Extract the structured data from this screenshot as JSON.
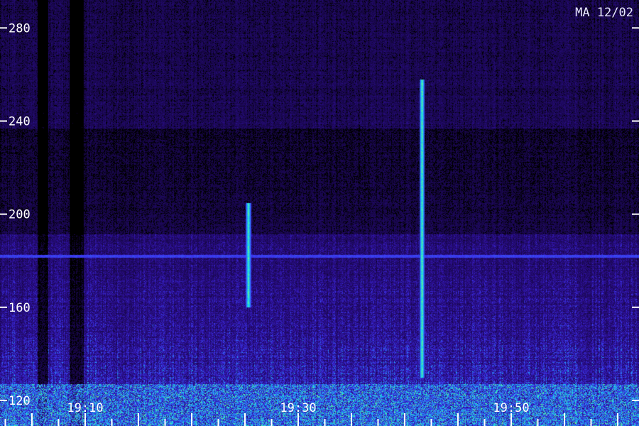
{
  "header": {
    "station_label": "MA 12/02"
  },
  "chart_data": {
    "type": "heatmap",
    "title": "",
    "xlabel": "",
    "ylabel": "",
    "y_ticks": [
      120,
      160,
      200,
      240,
      280
    ],
    "y_tick_labels": [
      "120",
      "160",
      "200",
      "240",
      "280"
    ],
    "ylim": [
      109,
      292
    ],
    "x_tick_labels": [
      "19:10",
      "19:30",
      "19:50"
    ],
    "x_tick_minutes": [
      10,
      30,
      50
    ],
    "xlim_minutes": [
      2,
      62
    ],
    "grid": false,
    "events": [
      {
        "kind": "meteor-trail",
        "minute": 41.6,
        "y_range": [
          130,
          258
        ]
      },
      {
        "kind": "meteor-trail",
        "minute": 25.3,
        "y_range": [
          160,
          205
        ]
      }
    ],
    "persistent_line_y": 182,
    "interference_bands_minutes": [
      [
        5.5,
        6.5
      ],
      [
        8.5,
        9.8
      ]
    ],
    "colors": {
      "background": "#000000",
      "low": "#2a0a6e",
      "mid": "#3a2bd8",
      "high": "#28e6ff",
      "peak": "#9cff3a"
    }
  }
}
